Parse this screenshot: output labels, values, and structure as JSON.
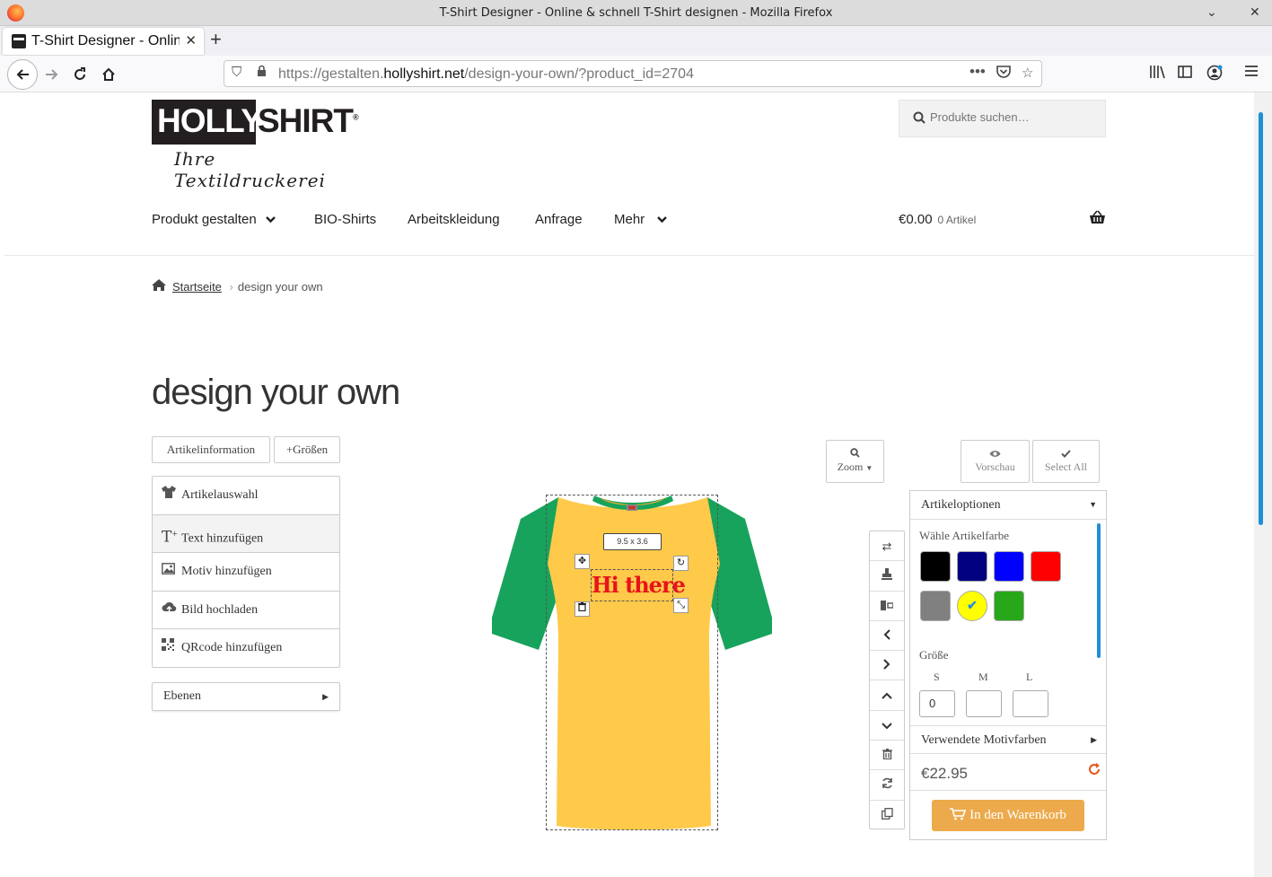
{
  "window": {
    "title": "T-Shirt Designer - Online & schnell T-Shirt designen - Mozilla Firefox",
    "minimize": "⌄",
    "close": "✕"
  },
  "browser": {
    "tab_title": "T-Shirt Designer - Online & schnell T-Shirt designen",
    "tab_close": "✕",
    "new_tab": "+",
    "url_prefix": "https://gestalten.",
    "url_domain": "hollyshirt.net",
    "url_path": "/design-your-own/?product_id=2704"
  },
  "site": {
    "logo_word1": "HOLLY",
    "logo_word2": "SHIRT",
    "logo_reg": "®",
    "logo_tagline": "Ihre Textildruckerei",
    "search_placeholder": "Produkte suchen…",
    "nav": [
      "Produkt gestalten",
      "BIO-Shirts",
      "Arbeitskleidung",
      "Anfrage",
      "Mehr"
    ],
    "cart_total": "€0.00",
    "cart_count": "0 Artikel",
    "breadcrumb_home": "Startseite",
    "breadcrumb_current": "design your own",
    "page_title": "design your own"
  },
  "designer": {
    "btn_info": "Artikelinformation",
    "btn_sizes": "+Größen",
    "panel": [
      {
        "label": "Artikelauswahl",
        "icon": "tshirt-icon"
      },
      {
        "label": "Text hinzufügen",
        "icon": "text-add-icon"
      },
      {
        "label": "Motiv hinzufügen",
        "icon": "image-icon"
      },
      {
        "label": "Bild hochladen",
        "icon": "cloud-upload-icon"
      },
      {
        "label": "QRcode hinzufügen",
        "icon": "qrcode-icon"
      }
    ],
    "layers_label": "Ebenen",
    "zoom_label": "Zoom",
    "preview_label": "Vorschau",
    "select_all_label": "Select All",
    "size_tag": "9.5 x 3.6",
    "design_text": "Hi there",
    "design_text_color": "#e8131b",
    "shirt_body_color": "#ffc94a",
    "shirt_sleeve_color": "#17a35b"
  },
  "options": {
    "header": "Artikeloptionen",
    "color_label": "Wähle Artikelfarbe",
    "colors": [
      "#000000",
      "#000080",
      "#0000ff",
      "#ff0000",
      "#808080",
      "#ffff00",
      "#28a71a"
    ],
    "selected_color": "#ffff00",
    "size_label": "Größe",
    "sizes": [
      {
        "name": "S",
        "value": "0"
      },
      {
        "name": "M",
        "value": ""
      },
      {
        "name": "L",
        "value": ""
      }
    ],
    "motif_colors_label": "Verwendete Motivfarben",
    "price": "€22.95",
    "cart_button": "In den Warenkorb"
  }
}
